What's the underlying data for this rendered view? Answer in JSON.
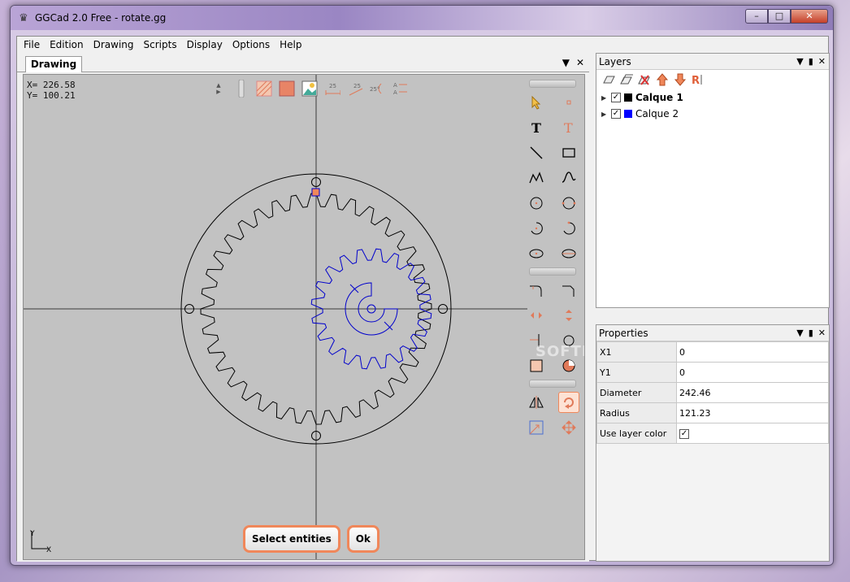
{
  "window": {
    "title": "GGCad 2.0 Free - rotate.gg",
    "controls": {
      "minimize": "–",
      "maximize": "□",
      "close": "✕"
    }
  },
  "menu": [
    "File",
    "Edition",
    "Drawing",
    "Scripts",
    "Display",
    "Options",
    "Help"
  ],
  "drawing": {
    "tab_label": "Drawing",
    "coords": {
      "x": "X= 226.58",
      "y": "Y= 100.21"
    },
    "buttons": {
      "select": "Select entities",
      "ok": "Ok"
    },
    "axis": {
      "x": "X",
      "y": "Y"
    },
    "watermark": "SOFTPEDIA"
  },
  "layers": {
    "title": "Layers",
    "items": [
      {
        "name": "Calque 1",
        "color": "#000000",
        "checked": true,
        "bold": true
      },
      {
        "name": "Calque 2",
        "color": "#0000ff",
        "checked": true,
        "bold": false
      }
    ]
  },
  "properties": {
    "title": "Properties",
    "rows": [
      {
        "key": "X1",
        "value": "0"
      },
      {
        "key": "Y1",
        "value": "0"
      },
      {
        "key": "Diameter",
        "value": "242.46"
      },
      {
        "key": "Radius",
        "value": "121.23"
      }
    ],
    "use_layer_color": {
      "key": "Use layer color",
      "checked": true
    }
  },
  "colors": {
    "accent": "#f0875a",
    "gear_outer": "#000000",
    "gear_inner": "#0000cc"
  }
}
